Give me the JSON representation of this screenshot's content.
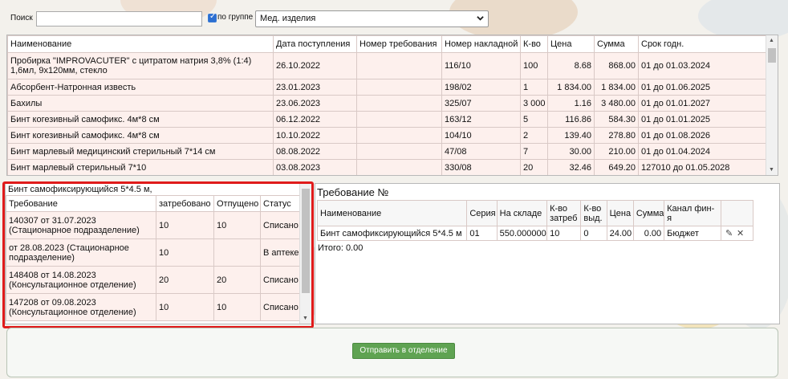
{
  "toolbar": {
    "search_label": "Поиск",
    "search_value": "",
    "group_checked": true,
    "group_label": "по группе",
    "category_selected": "Мед. изделия"
  },
  "items_table": {
    "headers": [
      "Наименование",
      "Дата поступления",
      "Номер требования",
      "Номер накладной",
      "К-во",
      "Цена",
      "Сумма",
      "Срок годн."
    ],
    "rows": [
      [
        "Пробирка \"IMPROVACUTER\" с цитратом натрия 3,8% (1:4) 1,6мл, 9х120мм, стекло",
        "26.10.2022",
        "",
        "116/10",
        "100",
        "8.68",
        "868.00",
        "01 до 01.03.2024"
      ],
      [
        "Абсорбент-Натронная известь",
        "23.01.2023",
        "",
        "198/02",
        "1",
        "1 834.00",
        "1 834.00",
        "01 до 01.06.2025"
      ],
      [
        "Бахилы",
        "23.06.2023",
        "",
        "325/07",
        "3 000",
        "1.16",
        "3 480.00",
        "01 до 01.01.2027"
      ],
      [
        "Бинт когезивный самофикс. 4м*8 см",
        "06.12.2022",
        "",
        "163/12",
        "5",
        "116.86",
        "584.30",
        "01 до 01.01.2025"
      ],
      [
        "Бинт когезивный самофикс. 4м*8 см",
        "10.10.2022",
        "",
        "104/10",
        "2",
        "139.40",
        "278.80",
        "01 до 01.08.2026"
      ],
      [
        "Бинт марлевый медицинский стерильный 7*14 см",
        "08.08.2022",
        "",
        "47/08",
        "7",
        "30.00",
        "210.00",
        "01 до 01.04.2024"
      ],
      [
        "Бинт марлевый стерильный 7*10",
        "03.08.2023",
        "",
        "330/08",
        "20",
        "32.46",
        "649.20",
        "127010 до 01.05.2028"
      ]
    ]
  },
  "requests_panel": {
    "title": "Бинт самофиксирующийся 5*4.5 м,",
    "headers": [
      "Требование",
      "затребовано",
      "Отпущено",
      "Статус"
    ],
    "rows": [
      [
        "140307 от 31.07.2023 (Стационарное подразделение)",
        "10",
        "10",
        "Списано"
      ],
      [
        "от 28.08.2023 (Стационарное подразделение)",
        "10",
        "",
        "В аптеке"
      ],
      [
        "148408 от 14.08.2023 (Консультационное отделение)",
        "20",
        "20",
        "Списано"
      ],
      [
        "147208 от 09.08.2023 (Консультационное отделение)",
        "10",
        "10",
        "Списано"
      ]
    ]
  },
  "demand_panel": {
    "title": "Требование №",
    "headers": [
      "Наименование",
      "Серия",
      "На складе",
      "К-во затреб",
      "К-во выд.",
      "Цена",
      "Сумма.",
      "Канал фин-я"
    ],
    "row": [
      "Бинт самофиксирующийся 5*4.5 м",
      "01",
      "550.000000",
      "10",
      "0",
      "24.00",
      "0.00",
      "Бюджет"
    ],
    "total": "Итого: 0.00",
    "edit_icon": "pencil-icon",
    "delete_icon": "close-icon"
  },
  "actions": {
    "send_label": "Отправить в отделение"
  },
  "colors": {
    "row_bg": "#fdf0ed",
    "highlight": "#e01b1b",
    "send_button": "#5fa352"
  }
}
